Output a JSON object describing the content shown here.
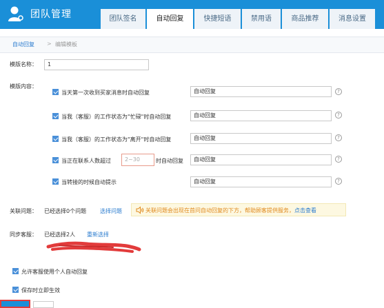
{
  "brand": {
    "title": "团队管理"
  },
  "tabs": [
    {
      "label": "团队签名",
      "active": false
    },
    {
      "label": "自动回复",
      "active": true
    },
    {
      "label": "快捷短语",
      "active": false
    },
    {
      "label": "禁用语",
      "active": false
    },
    {
      "label": "商品推荐",
      "active": false
    },
    {
      "label": "消息设置",
      "active": false
    }
  ],
  "breadcrumb": {
    "link": "自动回复",
    "separator": ">",
    "current": "编辑模板"
  },
  "template_name": {
    "label": "模版名称：",
    "value": "1"
  },
  "template_content": {
    "label": "模版内容：",
    "options": [
      {
        "text": "当天第一次收到买家消息时自动回复",
        "reply": "自动回复",
        "checked": true
      },
      {
        "text": "当我（客服）的工作状态为\"忙碌\"时自动回复",
        "reply": "自动回复",
        "checked": true
      },
      {
        "text": "当我（客服）的工作状态为\"离开\"时自动回复",
        "reply": "自动回复",
        "checked": true
      },
      {
        "text_before": "当正在联系人数超过",
        "threshold_placeholder": "2~30",
        "text_after": "时自动回复",
        "reply": "自动回复",
        "checked": true
      },
      {
        "text": "当转接的时候自动提示",
        "reply": "自动回复",
        "checked": true
      }
    ],
    "help_glyph": "?"
  },
  "related": {
    "label": "关联问题：",
    "status": "已经选择0个问题",
    "action": "选择问题",
    "notice_text": "关联问题会出现在首问自动回复的下方，帮助顾客提供服务，",
    "notice_link": "点击查看"
  },
  "sync": {
    "label": "同步客服：",
    "status": "已经选择2人",
    "action": "重新选择"
  },
  "settings": [
    {
      "text": "允许客服使用个人自动回复",
      "checked": true
    },
    {
      "text": "保存时立即生效",
      "checked": true
    }
  ],
  "colors": {
    "header": "#1a8fd8",
    "link": "#2b7ccf",
    "notice_bg": "#fdf8e1",
    "notice_text": "#e08a1e",
    "annotation": "#e23b3b"
  },
  "icons": {
    "brand": "user-icon",
    "notice": "speaker-icon",
    "help": "question-circle-icon"
  }
}
